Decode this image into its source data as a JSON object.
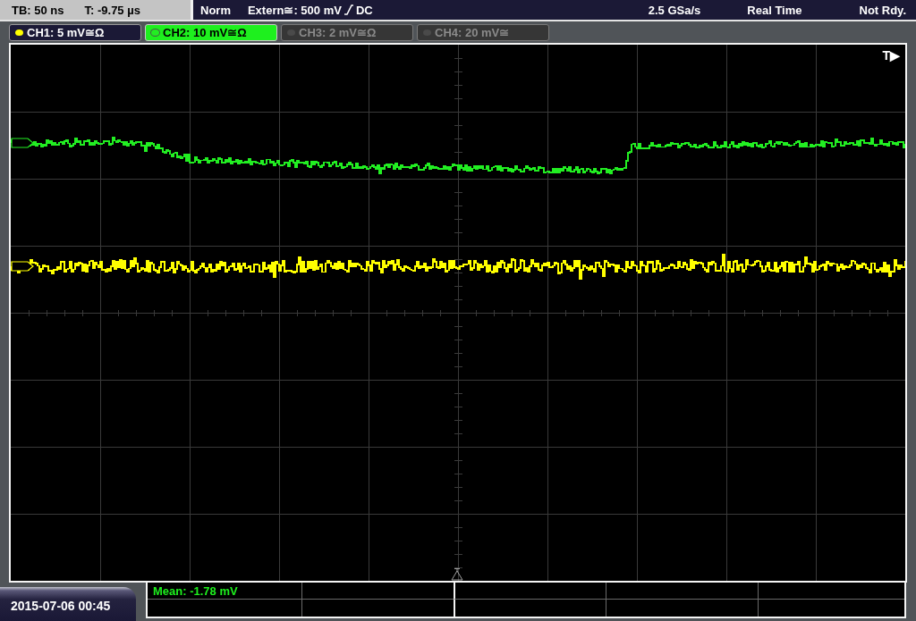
{
  "timebase": {
    "scale": "TB: 50 ns",
    "position": "T: -9.75 µs"
  },
  "trigger": {
    "mode": "Norm",
    "source": "Extern≅: 500 mV",
    "rising_edge": true,
    "coupling": "DC"
  },
  "acquisition": {
    "sample_rate": "2.5 GSa/s",
    "mode": "Real Time",
    "status": "Not Rdy."
  },
  "channels": [
    {
      "label": "CH1: 5 mV≅Ω",
      "on": true,
      "selected": false,
      "color": "#ffff00"
    },
    {
      "label": "CH2: 10 mV≅Ω",
      "on": true,
      "selected": true,
      "color": "#22ee22"
    },
    {
      "label": "CH3: 2 mV≅Ω",
      "on": false,
      "selected": false
    },
    {
      "label": "CH4: 20 mV≅",
      "on": false,
      "selected": false
    }
  ],
  "plot": {
    "trigger_marker": "T▶"
  },
  "date_time": "2015-07-06 00:45",
  "measurements": [
    {
      "text": "Mean: -1.78 mV"
    }
  ]
}
